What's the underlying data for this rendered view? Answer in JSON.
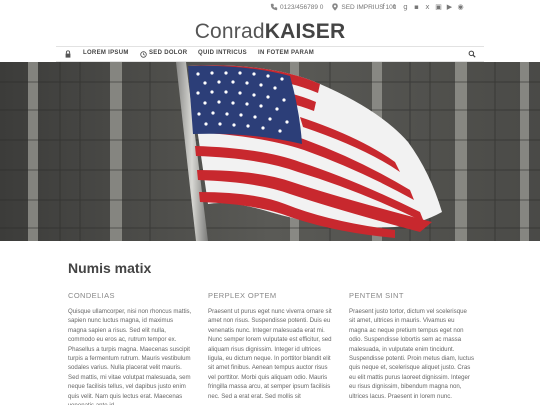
{
  "contact": {
    "phone": "0123/456789 0",
    "address": "SED IMPRIUS 100"
  },
  "social": {
    "icons": [
      "facebook-icon",
      "twitter-icon",
      "google-plus-icon",
      "linkedin-icon",
      "xing-icon",
      "instagram-icon",
      "youtube-icon",
      "pinterest-icon"
    ]
  },
  "logo": {
    "light": "Conrad",
    "bold": "KAISER"
  },
  "nav": {
    "items": [
      "LOREM IPSUM",
      "SED DOLOR",
      "QUID INTRICUS",
      "IN FOTEM PARAM"
    ]
  },
  "main": {
    "heading": "Numis matix",
    "columns": [
      {
        "title": "CONDELIAS",
        "text": "Quisque ullamcorper, nisi non rhoncus mattis, sapien nunc luctus magna, id maximus magna sapien a risus. Sed elit nulla, commodo eu eros ac, rutrum tempor ex. Phasellus a turpis magna. Maecenas suscipit turpis a fermentum rutrum. Mauris vestibulum sodales varius. Nulla placerat velit mauris. Sed mattis, mi vitae volutpat malesuada, sem neque facilisis tellus, vel dapibus justo enim quis velit. Nam quis lectus erat. Maecenas venenatis ante id"
      },
      {
        "title": "PERPLEX OPTEM",
        "text": "Praesent ut purus eget nunc viverra ornare sit amet non risus. Suspendisse potenti. Duis eu venenatis nunc. Integer malesuada erat mi. Nunc semper lorem vulputate est efficitur, sed aliquam risus dignissim. Integer id ultrices ligula, eu dictum neque. In porttitor blandit elit sit amet finibus. Aenean tempus auctor risus vel porttitor. Morbi quis aliquam odio. Mauris fringilla massa arcu, at semper ipsum facilisis nec. Sed a erat erat. Sed mollis sit"
      },
      {
        "title": "PENTEM SINT",
        "text": "Praesent justo tortor, dictum vel scelerisque sit amet, ultrices in mauris. Vivamus eu magna ac neque pretium tempus eget non odio. Suspendisse lobortis sem ac massa malesuada, in vulputate enim tincidunt. Suspendisse potenti. Proin metus diam, luctus quis neque et, scelerisque aliquet justo. Cras eu elit mattis purus laoreet dignissim. Integer eu risus dignissim, bibendum magna non, ultrices lacus. Praesent in lorem nunc."
      }
    ]
  },
  "colors": {
    "flag_red": "#c8282e",
    "flag_blue": "#2c3e78",
    "text": "#555555"
  }
}
